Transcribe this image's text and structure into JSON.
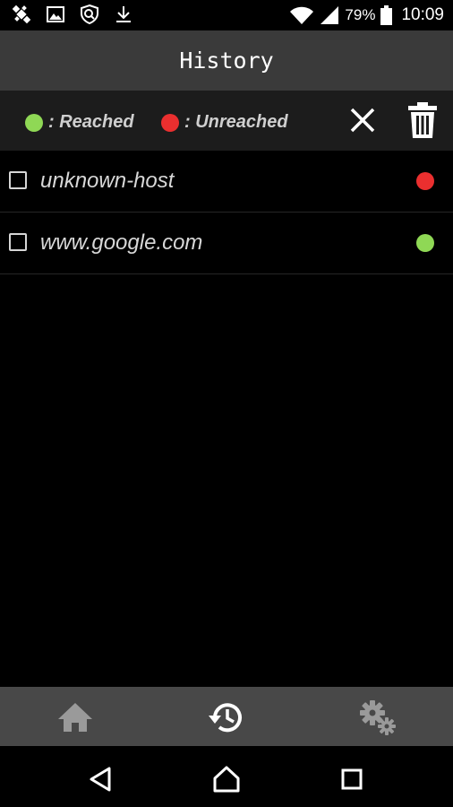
{
  "status_bar": {
    "icons_left": [
      "satellite-icon",
      "image-icon",
      "shield-icon",
      "download-icon"
    ],
    "icons_right": [
      "wifi-icon",
      "signal-icon",
      "battery-icon"
    ],
    "battery": "79%",
    "time": "10:09"
  },
  "app_bar": {
    "title": "History"
  },
  "legend": {
    "reached_label": ": Reached",
    "unreached_label": ": Unreached",
    "reached_color": "#8fd855",
    "unreached_color": "#ea2f2f"
  },
  "toolbar_icons": [
    "close-icon",
    "trash-icon"
  ],
  "history": [
    {
      "host": "unknown-host",
      "status": "unreached",
      "checked": false
    },
    {
      "host": "www.google.com",
      "status": "reached",
      "checked": false
    }
  ],
  "bottom_nav": {
    "items": [
      "home-icon",
      "history-icon",
      "settings-icon"
    ],
    "active": "history-icon"
  },
  "system_nav": {
    "items": [
      "back-icon",
      "home-circle-icon",
      "recents-icon"
    ]
  }
}
